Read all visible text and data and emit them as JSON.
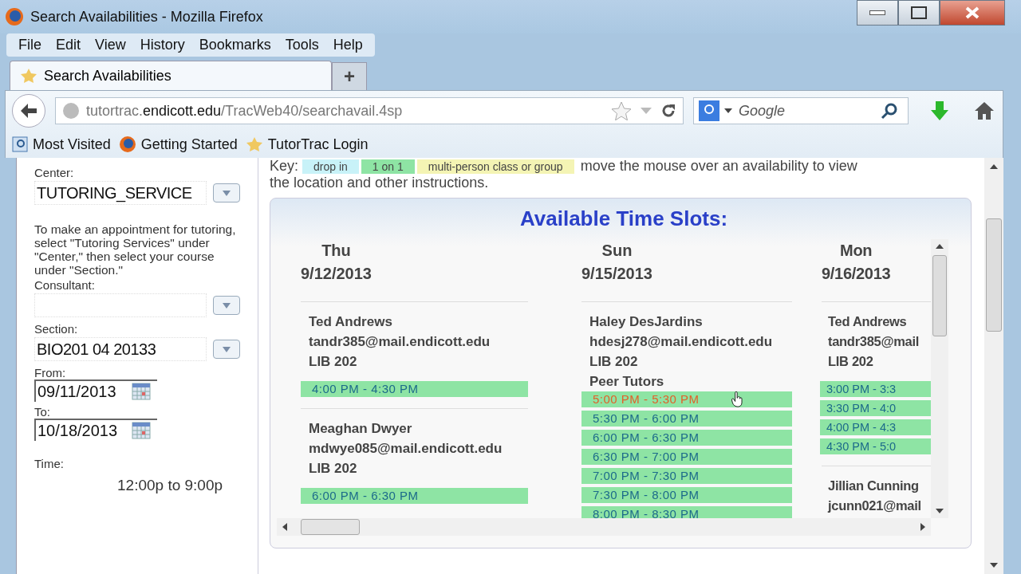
{
  "window": {
    "title": "Search Availabilities - Mozilla Firefox"
  },
  "menu": [
    "File",
    "Edit",
    "View",
    "History",
    "Bookmarks",
    "Tools",
    "Help"
  ],
  "tabs": [
    {
      "label": "Search Availabilities",
      "selected": true
    }
  ],
  "new_tab": "+",
  "address": {
    "host_prefix": "tutortrac.",
    "host": "endicott.edu",
    "path": "/TracWeb40/searchavail.4sp"
  },
  "search": {
    "placeholder": "Google"
  },
  "bookmarks": [
    {
      "label": "Most Visited",
      "kind": "folder"
    },
    {
      "label": "Getting Started",
      "kind": "firefox"
    },
    {
      "label": "TutorTrac Login",
      "kind": "tutortrac"
    }
  ],
  "sidebar": {
    "center_label": "Center:",
    "center_value": "TUTORING_SERVICE",
    "instructions": "To make an appointment for tutoring, select \"Tutoring Services\" under \"Center,\" then select your course under \"Section.\"",
    "consultant_label": "Consultant:",
    "section_label": "Section:",
    "section_value": "BIO201 04 20133",
    "from_label": "From:",
    "from_value": "09/11/2013",
    "to_label": "To:",
    "to_value": "10/18/2013",
    "time_label": "Time:",
    "time_value": "12:00p to 9:00p"
  },
  "key": {
    "label": "Key:",
    "items": [
      {
        "label": "drop in",
        "color": "#c8f2f8"
      },
      {
        "label": "1 on 1",
        "color": "#8ee4a4"
      },
      {
        "label": "multi-person class or group",
        "color": "#f4f4b4"
      }
    ],
    "note_lines": [
      "move the mouse over an availability to view",
      "the location and other instructions."
    ]
  },
  "slots_panel": {
    "title": "Available Time Slots:",
    "days": [
      {
        "day": "Thu",
        "date": "9/12/2013",
        "tutors": [
          {
            "name": "Ted Andrews",
            "email": "tandr385@mail.endicott.edu",
            "room": "LIB 202",
            "slots": [
              {
                "time": "4:00 PM - 4:30 PM",
                "hovered": false
              }
            ]
          },
          {
            "name": "Meaghan Dwyer",
            "email": "mdwye085@mail.endicott.edu",
            "room": "LIB 202",
            "slots": [
              {
                "time": "6:00 PM - 6:30 PM",
                "hovered": false
              }
            ]
          }
        ]
      },
      {
        "day": "Sun",
        "date": "9/15/2013",
        "tutors": [
          {
            "name": "Haley DesJardins",
            "email": "hdesj278@mail.endicott.edu",
            "room": "LIB 202",
            "note": "Peer Tutors",
            "slots": [
              {
                "time": "5:00 PM - 5:30 PM",
                "hovered": true
              },
              {
                "time": "5:30 PM - 6:00 PM",
                "hovered": false
              },
              {
                "time": "6:00 PM - 6:30 PM",
                "hovered": false
              },
              {
                "time": "6:30 PM - 7:00 PM",
                "hovered": false
              },
              {
                "time": "7:00 PM - 7:30 PM",
                "hovered": false
              },
              {
                "time": "7:30 PM - 8:00 PM",
                "hovered": false
              },
              {
                "time": "8:00 PM - 8:30 PM",
                "hovered": false
              }
            ]
          }
        ]
      },
      {
        "day": "Mon",
        "date": "9/16/2013",
        "tutors": [
          {
            "name": "Ted Andrews",
            "email": "tandr385@mail",
            "room": "LIB 202",
            "slots": [
              {
                "time": "3:00 PM - 3:3",
                "hovered": false
              },
              {
                "time": "3:30 PM - 4:0",
                "hovered": false
              },
              {
                "time": "4:00 PM - 4:3",
                "hovered": false
              },
              {
                "time": "4:30 PM - 5:0",
                "hovered": false
              }
            ]
          },
          {
            "name": "Jillian Cunning",
            "email": "jcunn021@mail"
          }
        ]
      }
    ]
  }
}
